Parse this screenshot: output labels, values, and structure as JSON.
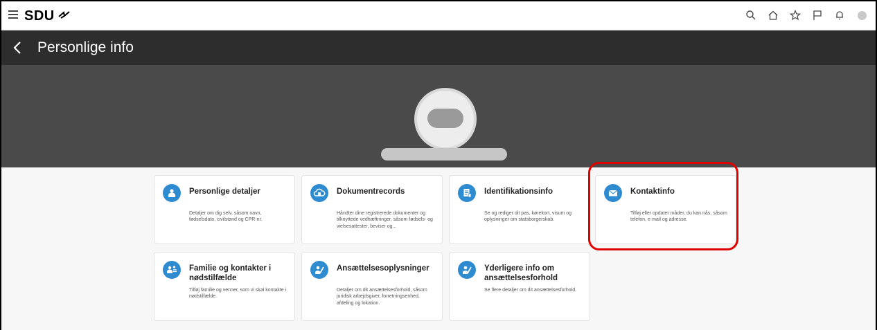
{
  "app": {
    "brand": "SDU",
    "top_icons": [
      "search-icon",
      "home-icon",
      "star-icon",
      "flag-icon",
      "bell-icon",
      "user-avatar"
    ]
  },
  "header": {
    "title": "Personlige info"
  },
  "colors": {
    "titlebar": "#2d2d2d",
    "banner": "#4a4a4a",
    "accent": "#2e8bd0",
    "highlight": "#e00000"
  },
  "tiles": [
    {
      "title": "Personlige detaljer",
      "description": "Detaljer om dig selv, såsom navn, fødselsdato, civilstand og CPR-nr.",
      "icon": "person-icon"
    },
    {
      "title": "Dokumentrecords",
      "description": "Håndter dine registrerede dokumenter og tilknyttede vedhæftninger, såsom fødsels- og vielsesattester, beviser og...",
      "icon": "cloud-document-icon"
    },
    {
      "title": "Identifikationsinfo",
      "description": "Se og rediger dit pas, kørekort, visum og oplysninger om statsborgerskab.",
      "icon": "id-document-icon"
    },
    {
      "title": "Kontaktinfo",
      "description": "Tilføj eller opdater måder, du kan nås, såsom telefon, e-mail og adresse.",
      "icon": "envelope-icon"
    },
    {
      "title": "Familie og kontakter i nødstilfælde",
      "description": "Tilføj familie og venner, som vi skal kontakte i nødstilfælde.",
      "icon": "family-contacts-icon"
    },
    {
      "title": "Ansættelsesoplysninger",
      "description": "Detaljer om dit ansættelsesforhold, såsom juridisk arbejdsgiver, forretningsenhed, afdeling og lokation.",
      "icon": "person-edit-icon"
    },
    {
      "title": "Yderligere info om ansættelsesforhold",
      "description": "Se flere detaljer om dit ansættelsesforhold.",
      "icon": "person-edit-icon"
    }
  ]
}
